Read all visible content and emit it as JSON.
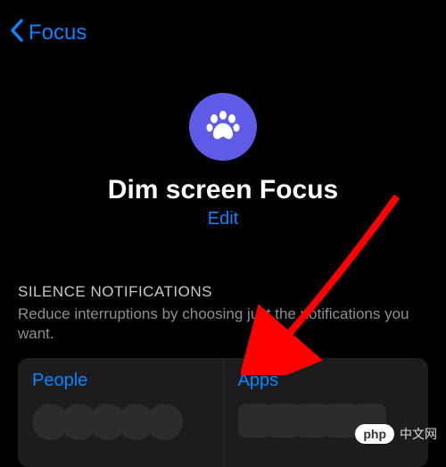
{
  "nav": {
    "back_label": "Focus"
  },
  "focus": {
    "title": "Dim screen Focus",
    "edit_label": "Edit"
  },
  "section": {
    "header": "SILENCE NOTIFICATIONS",
    "description": "Reduce interruptions by choosing just the notifications you want."
  },
  "cards": {
    "people_label": "People",
    "apps_label": "Apps"
  },
  "watermark": {
    "badge": "php",
    "text": "中文网"
  }
}
